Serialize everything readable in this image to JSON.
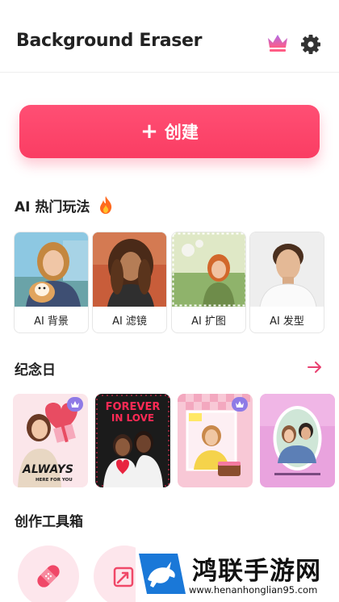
{
  "header": {
    "title": "Background Eraser",
    "crown_icon": "crown-icon",
    "settings_icon": "gear-icon"
  },
  "create_button": {
    "plus": "+",
    "label": "创建"
  },
  "ai_section": {
    "title": "AI 热门玩法",
    "icon": "fire-icon",
    "cards": [
      {
        "label": "AI 背景"
      },
      {
        "label": "AI 滤镜"
      },
      {
        "label": "AI 扩图"
      },
      {
        "label": "AI 发型"
      }
    ]
  },
  "anniversary_section": {
    "title": "纪念日",
    "more_icon": "arrow-right-icon",
    "cards": [
      {
        "text_line1": "ALWAYS",
        "text_line2": "HERE FOR YOU"
      },
      {
        "text_line1": "FOREVER",
        "text_line2": "IN LOVE"
      },
      {
        "text_line1": "",
        "text_line2": ""
      },
      {
        "text_line1": "",
        "text_line2": ""
      }
    ]
  },
  "tools_section": {
    "title": "创作工具箱",
    "icons": [
      "bandage-icon",
      "ai-expand-icon"
    ]
  },
  "watermark": {
    "text": "鸿联手游网",
    "url": "www.henanhonglian95.com"
  },
  "colors": {
    "accent": "#fa3d63",
    "vip": "#8f7ae6",
    "arrow": "#e94070"
  }
}
